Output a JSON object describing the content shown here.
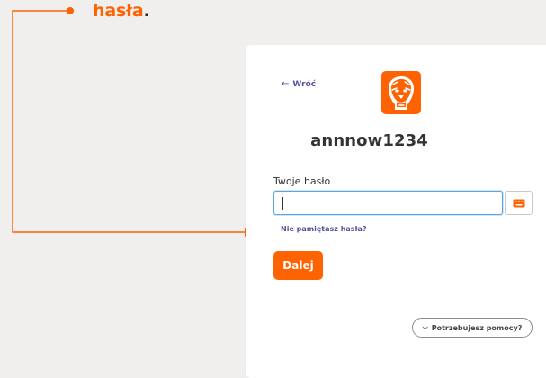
{
  "annotation": {
    "text": "hasła",
    "punct": ".",
    "color": "#ff6200"
  },
  "card": {
    "back_label": "Wróć",
    "back_icon": "arrow-left-icon",
    "logo_icon": "ing-lion-logo",
    "username": "annnow1234",
    "password_label": "Twoje hasło",
    "password_value": "",
    "keyboard_icon": "virtual-keyboard-icon",
    "forgot_label": "Nie pamiętasz hasła?",
    "next_label": "Dalej",
    "help_label": "Potrzebujesz pomocy?",
    "help_icon": "chevron-down-icon"
  },
  "colors": {
    "brand_orange": "#ff6200",
    "link_purple": "#525199",
    "background": "#f0efed"
  }
}
